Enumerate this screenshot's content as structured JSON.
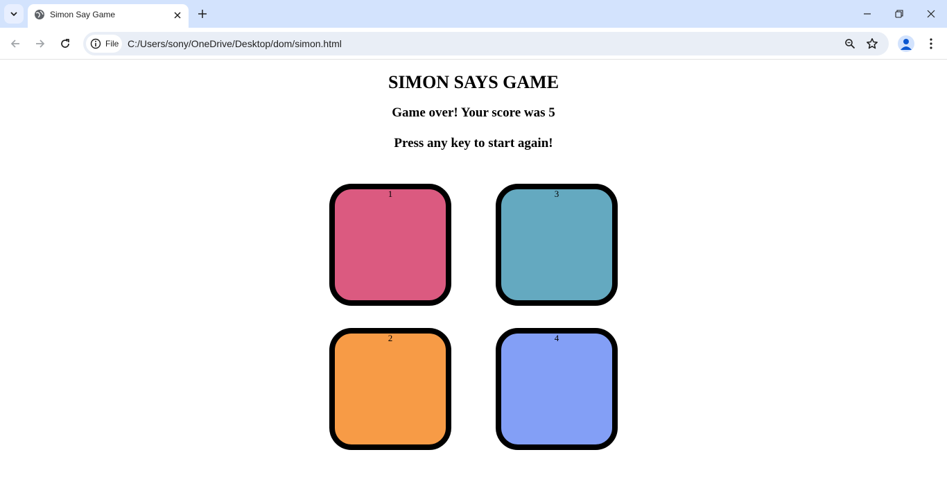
{
  "browser": {
    "tab": {
      "title": "Simon Say Game"
    },
    "address": {
      "scheme_label": "File",
      "url": "C:/Users/sony/OneDrive/Desktop/dom/simon.html"
    }
  },
  "page": {
    "title": "SIMON SAYS GAME",
    "status_line_1": "Game over! Your score was 5",
    "status_line_2": "Press any key to start again!",
    "buttons": [
      {
        "label": "1",
        "color": "#db5a80"
      },
      {
        "label": "2",
        "color": "#f79b46"
      },
      {
        "label": "3",
        "color": "#64a9c0"
      },
      {
        "label": "4",
        "color": "#839ff6"
      }
    ]
  },
  "colors": {
    "tabstrip_bg": "#d3e3fd",
    "omnibox_bg": "#e9eef6",
    "button_border": "#000000"
  },
  "icons": [
    "tab-search-icon",
    "globe-icon",
    "close-icon",
    "plus-icon",
    "minimize-icon",
    "restore-icon",
    "back-icon",
    "forward-icon",
    "reload-icon",
    "info-icon",
    "zoom-icon",
    "star-icon",
    "profile-icon",
    "more-vert-icon"
  ]
}
